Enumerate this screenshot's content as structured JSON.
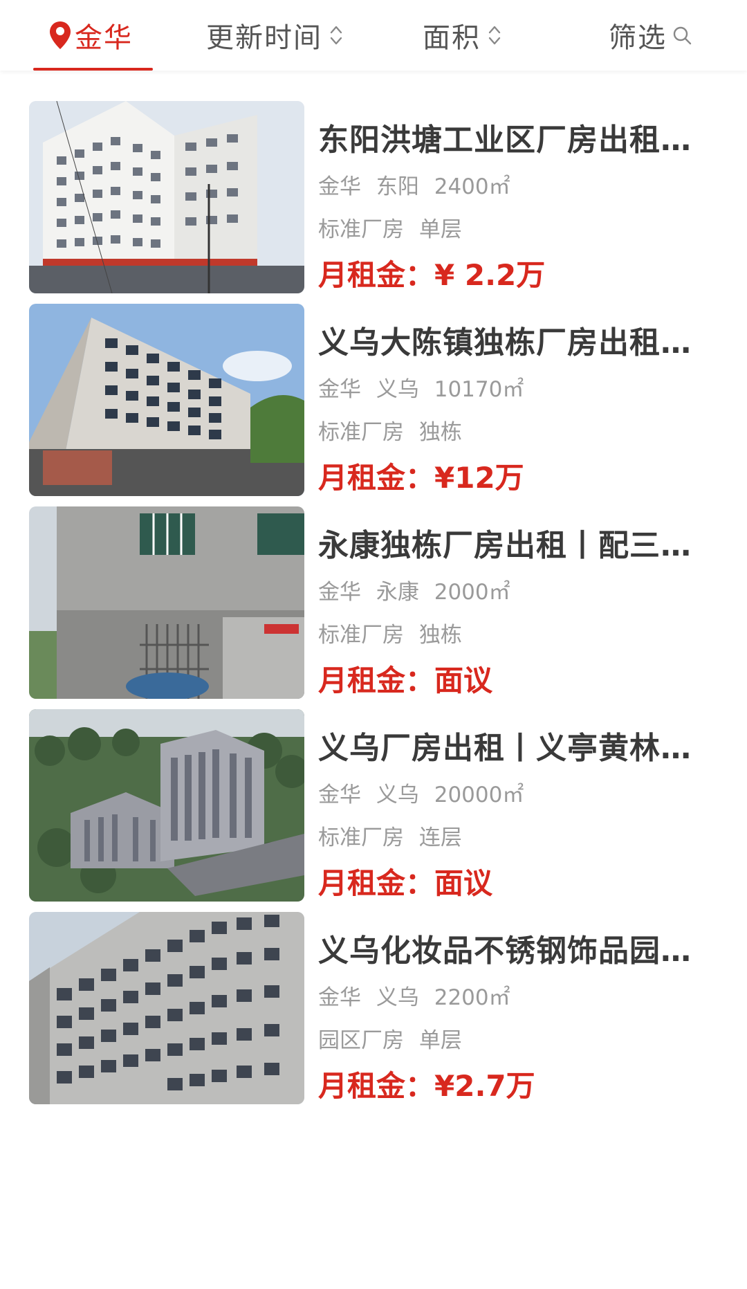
{
  "filter_bar": {
    "city": "金华",
    "update_time": "更新时间",
    "area": "面积",
    "filter": "筛选"
  },
  "colors": {
    "accent": "#d8281e",
    "title": "#3a3a3a",
    "secondary": "#9a9a9a"
  },
  "listings": [
    {
      "title": "东阳洪塘工业区厂房出租…",
      "city": "金华",
      "district": "东阳",
      "area": "2400㎡",
      "type": "标准厂房",
      "floor": "单层",
      "price_label": "月租金：",
      "price": "¥ 2.2万"
    },
    {
      "title": "义乌大陈镇独栋厂房出租…",
      "city": "金华",
      "district": "义乌",
      "area": "10170㎡",
      "type": "标准厂房",
      "floor": "独栋",
      "price_label": "月租金：",
      "price": "¥12万"
    },
    {
      "title": "永康独栋厂房出租丨配三…",
      "city": "金华",
      "district": "永康",
      "area": "2000㎡",
      "type": "标准厂房",
      "floor": "独栋",
      "price_label": "月租金：",
      "price": "面议"
    },
    {
      "title": "义乌厂房出租丨义亭黄林…",
      "city": "金华",
      "district": "义乌",
      "area": "20000㎡",
      "type": "标准厂房",
      "floor": "连层",
      "price_label": "月租金：",
      "price": "面议"
    },
    {
      "title": "义乌化妆品不锈钢饰品园…",
      "city": "金华",
      "district": "义乌",
      "area": "2200㎡",
      "type": "园区厂房",
      "floor": "单层",
      "price_label": "月租金：",
      "price": "¥2.7万"
    }
  ]
}
